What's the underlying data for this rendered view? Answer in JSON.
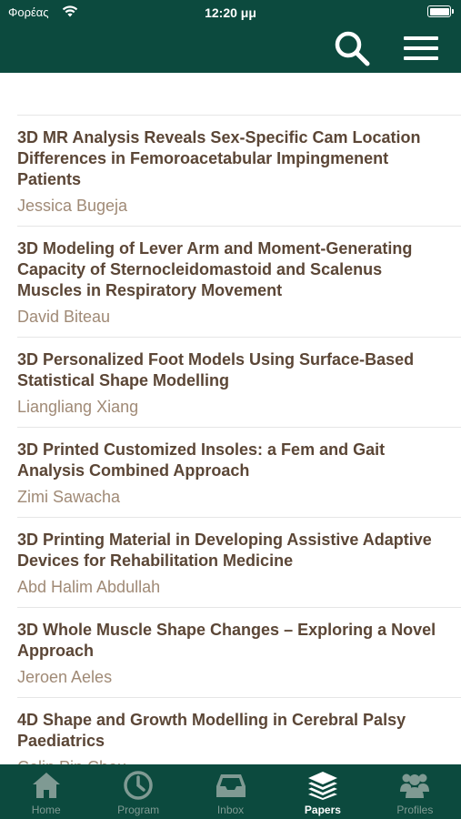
{
  "status_bar": {
    "carrier": "Φορέας",
    "time": "12:20 μμ"
  },
  "header": {
    "search_icon": "search-icon",
    "menu_icon": "hamburger-menu-icon"
  },
  "papers": [
    {
      "title": "3D MR Analysis Reveals Sex-Specific Cam Location Differences in Femoroacetabular Impingmenent Patients",
      "author": "Jessica Bugeja"
    },
    {
      "title": "3D Modeling of Lever Arm and Moment-Generating Capacity of Sternocleidomastoid and Scalenus Muscles in Respiratory Movement",
      "author": "David Biteau"
    },
    {
      "title": "3D Personalized Foot Models Using Surface-Based Statistical Shape Modelling",
      "author": "Liangliang Xiang"
    },
    {
      "title": "3D Printed Customized Insoles: a Fem and Gait Analysis Combined Approach",
      "author": "Zimi Sawacha"
    },
    {
      "title": "3D Printing Material in Developing Assistive Adaptive Devices for Rehabilitation Medicine",
      "author": "Abd Halim Abdullah"
    },
    {
      "title": "3D Whole Muscle Shape Changes – Exploring a Novel Approach",
      "author": "Jeroen Aeles"
    },
    {
      "title": "4D Shape and Growth Modelling in Cerebral Palsy Paediatrics",
      "author": "Colin Pin Chou"
    }
  ],
  "tabs": [
    {
      "label": "Home",
      "icon": "home-icon"
    },
    {
      "label": "Program",
      "icon": "clock-icon"
    },
    {
      "label": "Inbox",
      "icon": "inbox-icon"
    },
    {
      "label": "Papers",
      "icon": "layers-icon"
    },
    {
      "label": "Profiles",
      "icon": "people-icon"
    }
  ],
  "active_tab": "Papers",
  "colors": {
    "header_bg": "#0c4a3e",
    "title_text": "#5b4636",
    "author_text": "#a08a76",
    "tab_inactive": "#7f9a93",
    "tab_active": "#ffffff"
  }
}
